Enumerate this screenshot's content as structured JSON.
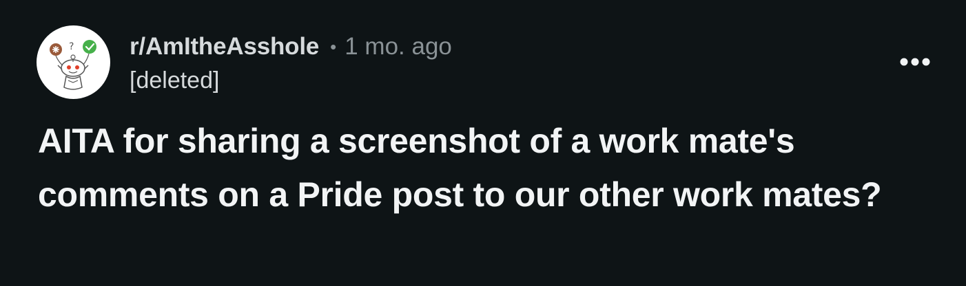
{
  "post": {
    "subreddit": "r/AmItheAsshole",
    "separator": "•",
    "timestamp": "1 mo. ago",
    "author": "[deleted]",
    "title": "AITA for sharing a screenshot of a work mate's comments on a Pride post to our other work mates?",
    "avatar_icon": "snoo-avatar-icon",
    "more_icon": "more-options-icon"
  },
  "colors": {
    "background": "#0e1416",
    "title_text": "#f2f4f5",
    "meta_text": "#d6dadc",
    "secondary_text": "#8a9296"
  }
}
